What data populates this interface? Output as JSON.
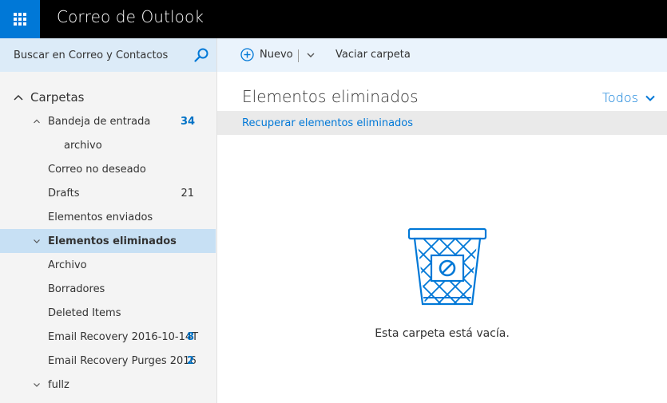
{
  "header": {
    "app_title": "Correo de Outlook",
    "launcher_icon": "waffle-icon"
  },
  "search": {
    "placeholder": "Buscar en Correo y Contactos",
    "icon": "search-icon"
  },
  "toolbar": {
    "new_label": "Nuevo",
    "empty_folder_label": "Vaciar carpeta"
  },
  "sidebar": {
    "folders_header": "Carpetas",
    "folders": [
      {
        "name": "Bandeja de entrada",
        "count": "34",
        "expand": "collapse"
      },
      {
        "name": "archivo",
        "count": ""
      },
      {
        "name": "Correo no deseado",
        "count": ""
      },
      {
        "name": "Drafts",
        "count": "21"
      },
      {
        "name": "Elementos enviados",
        "count": ""
      },
      {
        "name": "Elementos eliminados",
        "count": "",
        "selected": true,
        "expand": "expand"
      },
      {
        "name": "Archivo",
        "count": ""
      },
      {
        "name": "Borradores",
        "count": ""
      },
      {
        "name": "Deleted Items",
        "count": ""
      },
      {
        "name": "Email Recovery 2016-10-14T",
        "count": "8"
      },
      {
        "name": "Email Recovery Purges 2016",
        "count": "2"
      },
      {
        "name": "fullz",
        "count": "",
        "expand": "expand"
      }
    ]
  },
  "main": {
    "folder_title": "Elementos eliminados",
    "filter_label": "Todos",
    "recover_link": "Recuperar elementos eliminados",
    "empty_message": "Esta carpeta está vacía."
  },
  "colors": {
    "accent": "#0078d7",
    "header_bg": "#000000",
    "selected_bg": "#c7e0f4",
    "search_bg": "#dcebf8",
    "toolbar_bg": "#eaf3fc"
  }
}
